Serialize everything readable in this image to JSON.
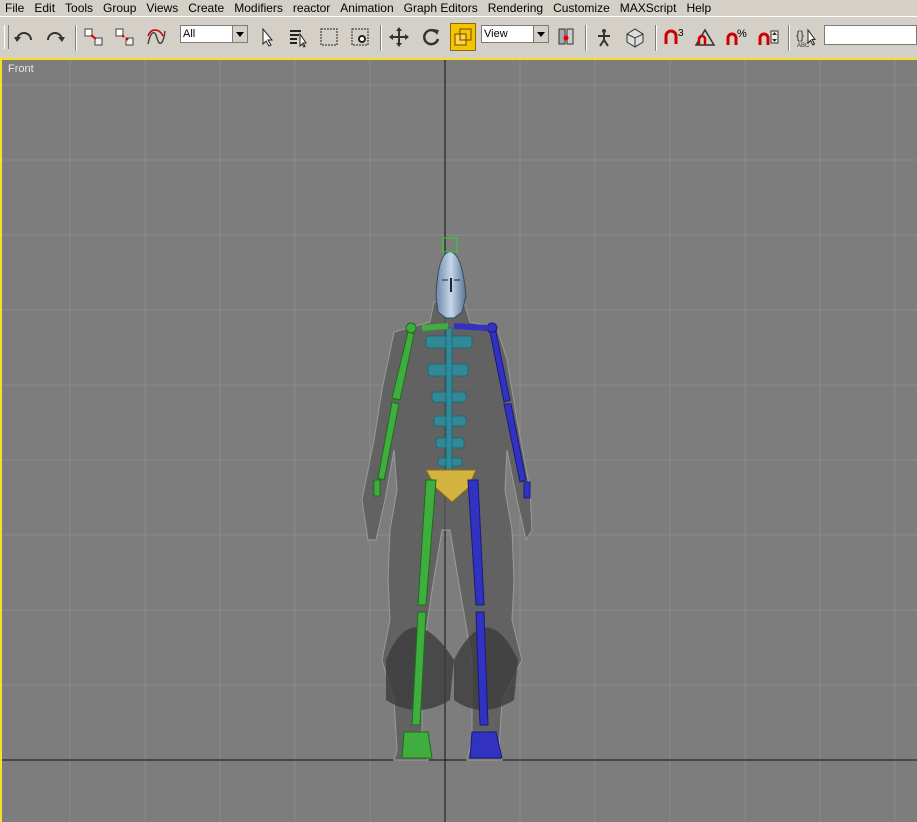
{
  "menu": [
    "File",
    "Edit",
    "Tools",
    "Group",
    "Views",
    "Create",
    "Modifiers",
    "reactor",
    "Animation",
    "Graph Editors",
    "Rendering",
    "Customize",
    "MAXScript",
    "Help"
  ],
  "toolbar": {
    "selection_filter": "All",
    "reference_coord": "View",
    "snap_angle_label": "3",
    "percent_snap_label": "%",
    "named_selection_value": ""
  },
  "viewport": {
    "label": "Front",
    "border_color": "#f2e326",
    "background": "#7d7d7d"
  },
  "icons": [
    "undo-icon",
    "redo-icon",
    "select-link-icon",
    "unlink-icon",
    "bind-space-warp-icon",
    "select-object-icon",
    "select-by-name-icon",
    "rectangular-region-icon",
    "window-crossing-icon",
    "select-move-icon",
    "select-rotate-icon",
    "select-scale-icon",
    "use-pivot-center-icon",
    "select-manipulate-icon",
    "keyboard-shortcut-override-icon",
    "snaps-toggle-icon",
    "angle-snap-icon",
    "percent-snap-icon",
    "spinner-snap-icon",
    "edit-named-selection-icon",
    "mirror-icon"
  ]
}
